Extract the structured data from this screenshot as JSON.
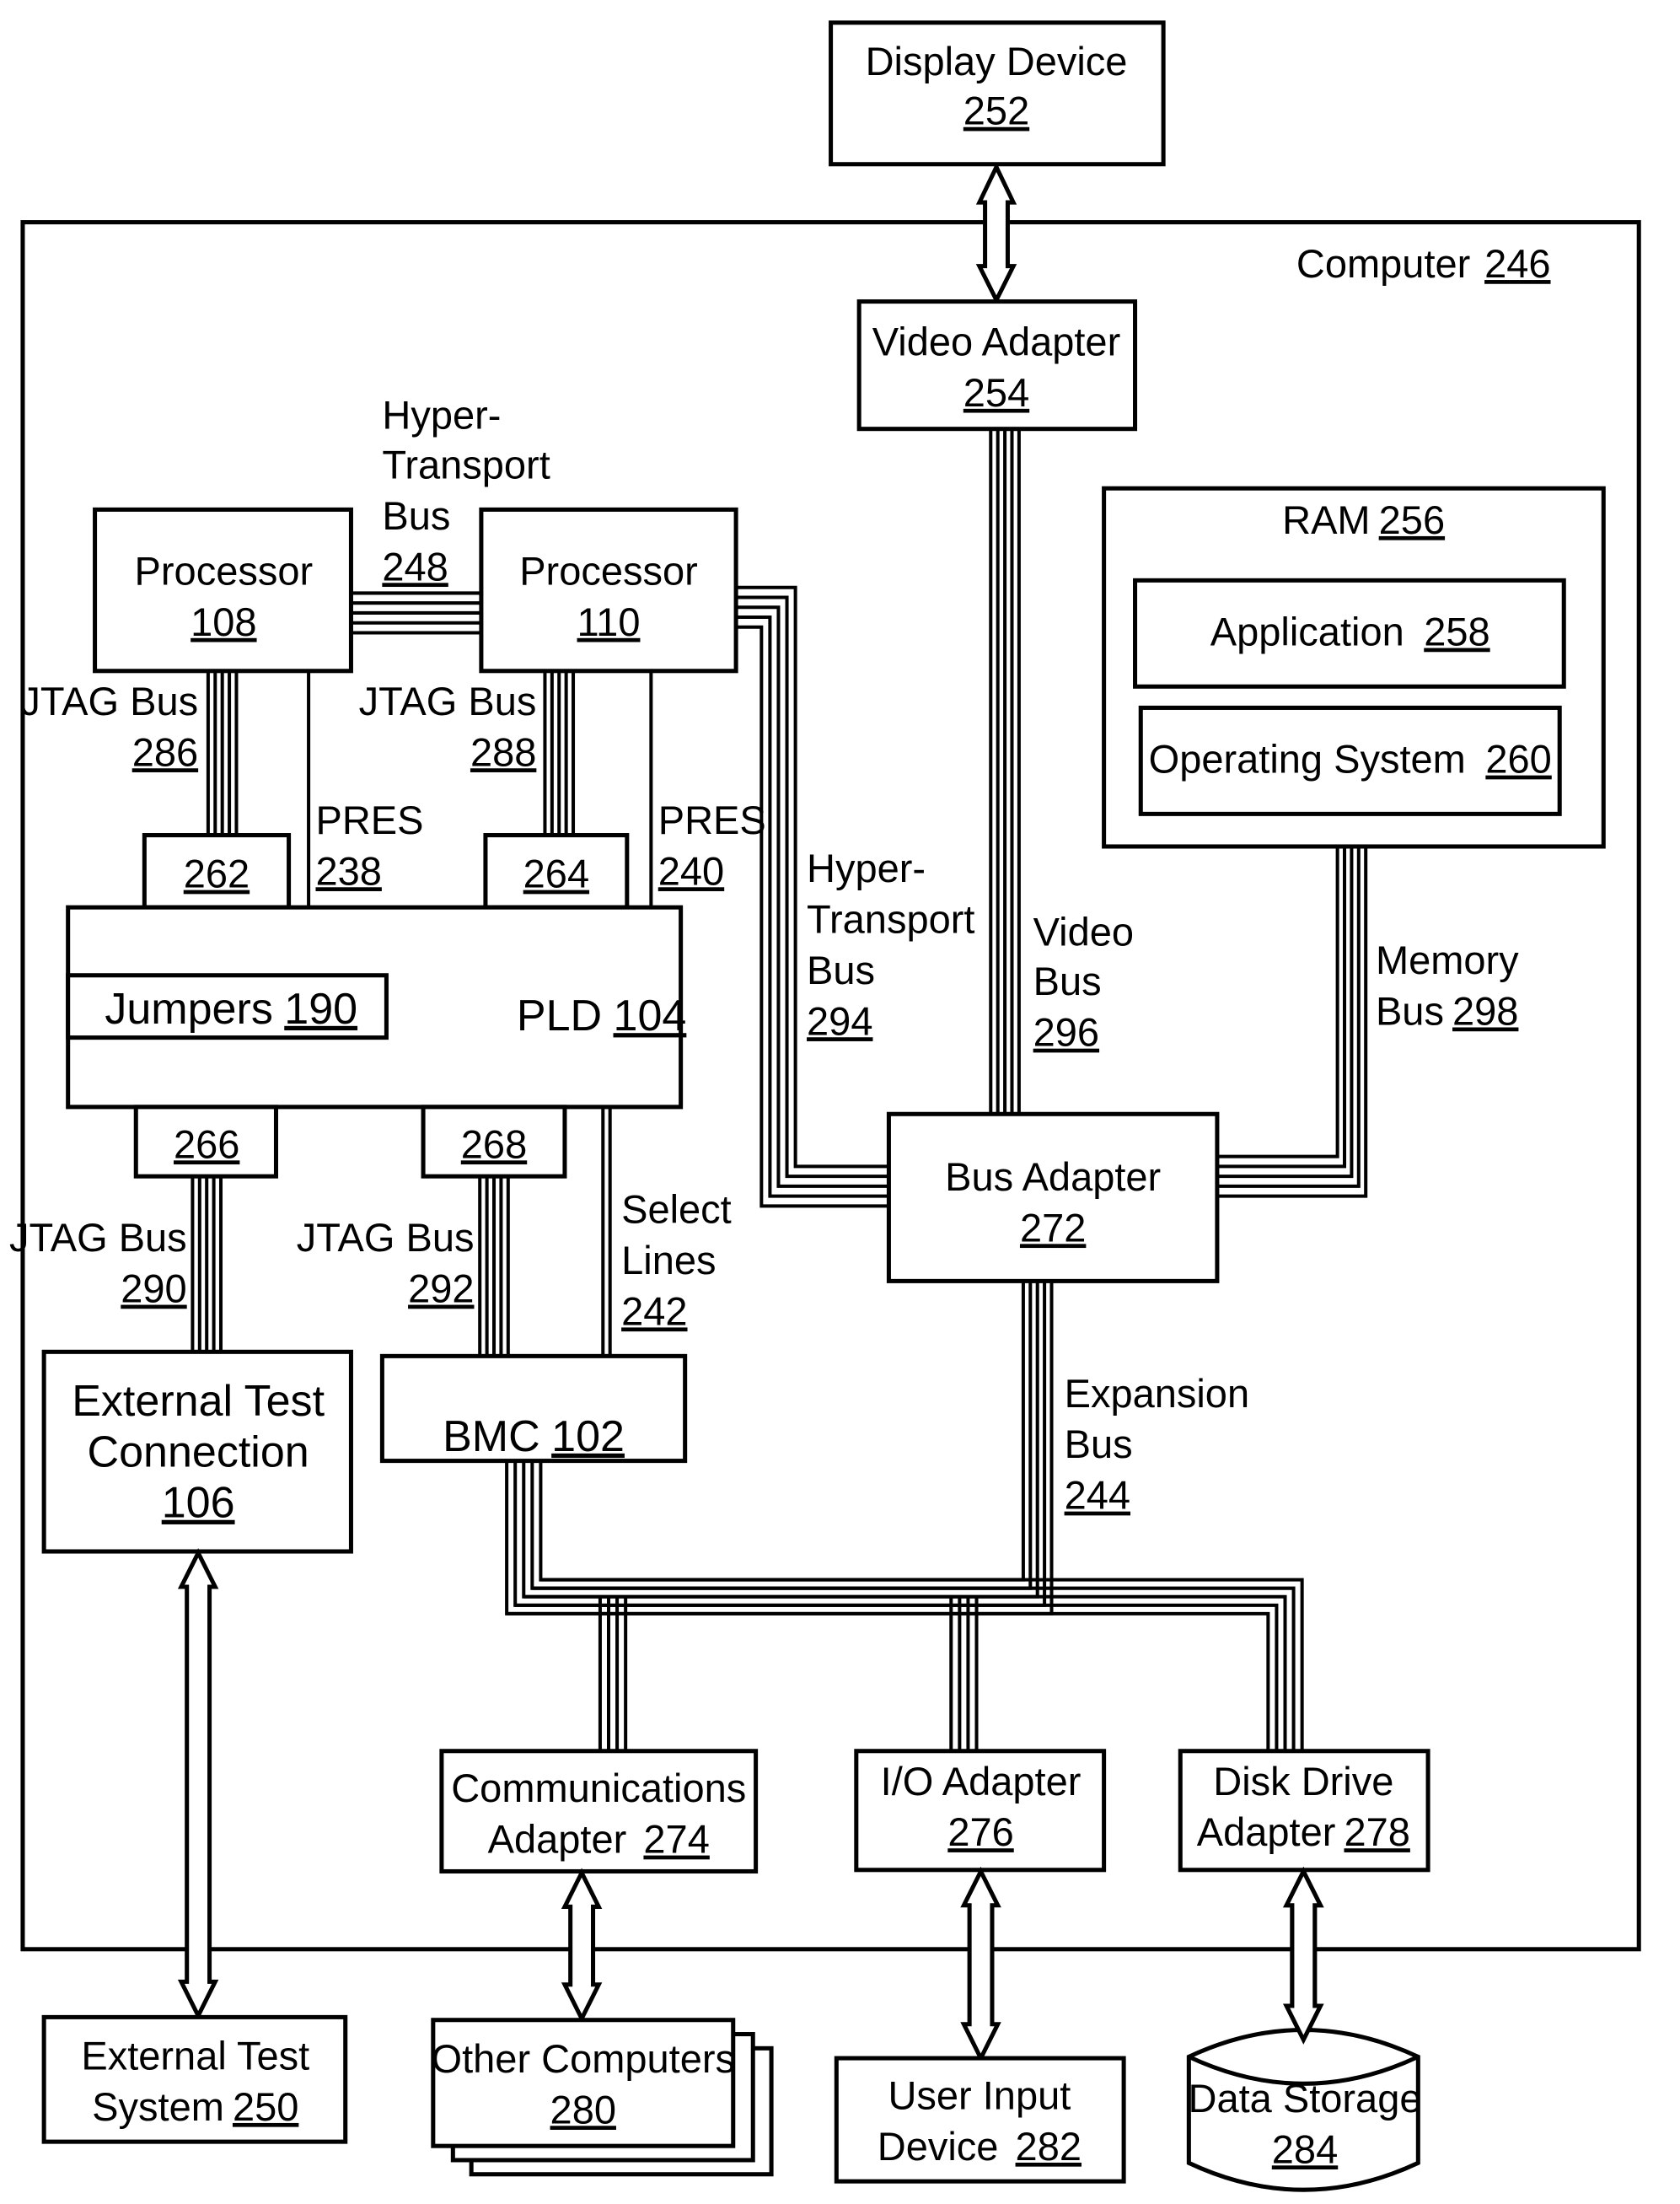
{
  "diagram": {
    "computer": {
      "label": "Computer",
      "ref": "246"
    },
    "display_device": {
      "label": "Display Device",
      "ref": "252"
    },
    "video_adapter": {
      "label": "Video Adapter",
      "ref": "254"
    },
    "ram": {
      "label": "RAM",
      "ref": "256"
    },
    "application": {
      "label": "Application",
      "ref": "258"
    },
    "operating_system": {
      "label": "Operating System",
      "ref": "260"
    },
    "processor_108": {
      "label": "Processor",
      "ref": "108"
    },
    "processor_110": {
      "label": "Processor",
      "ref": "110"
    },
    "ht_bus_248": {
      "line1": "Hyper-",
      "line2": "Transport",
      "line3": "Bus",
      "ref": "248"
    },
    "jtag_286": {
      "label": "JTAG Bus",
      "ref": "286"
    },
    "jtag_288": {
      "label": "JTAG Bus",
      "ref": "288"
    },
    "pres_238": {
      "label": "PRES",
      "ref": "238"
    },
    "pres_240": {
      "label": "PRES",
      "ref": "240"
    },
    "port_262": {
      "ref": "262"
    },
    "port_264": {
      "ref": "264"
    },
    "port_266": {
      "ref": "266"
    },
    "port_268": {
      "ref": "268"
    },
    "pld": {
      "label": "PLD",
      "ref": "104"
    },
    "jumpers": {
      "label": "Jumpers",
      "ref": "190"
    },
    "ht_bus_294": {
      "line1": "Hyper-",
      "line2": "Transport",
      "line3": "Bus",
      "ref": "294"
    },
    "video_bus": {
      "line1": "Video",
      "line2": "Bus",
      "ref": "296"
    },
    "memory_bus": {
      "line1": "Memory",
      "line2": "Bus",
      "ref": "298"
    },
    "bus_adapter": {
      "label": "Bus Adapter",
      "ref": "272"
    },
    "jtag_290": {
      "label": "JTAG Bus",
      "ref": "290"
    },
    "jtag_292": {
      "label": "JTAG Bus",
      "ref": "292"
    },
    "select_lines": {
      "line1": "Select",
      "line2": "Lines",
      "ref": "242"
    },
    "expansion_bus": {
      "line1": "Expansion",
      "line2": "Bus",
      "ref": "244"
    },
    "ext_test_conn": {
      "line1": "External Test",
      "line2": "Connection",
      "ref": "106"
    },
    "bmc": {
      "label": "BMC",
      "ref": "102"
    },
    "comm_adapter": {
      "line1": "Communications",
      "line2": "Adapter",
      "ref": "274"
    },
    "io_adapter": {
      "label": "I/O Adapter",
      "ref": "276"
    },
    "disk_adapter": {
      "line1": "Disk Drive",
      "line2": "Adapter",
      "ref": "278"
    },
    "ext_test_system": {
      "line1": "External Test",
      "line2": "System",
      "ref": "250"
    },
    "other_computers": {
      "label": "Other Computers",
      "ref": "280"
    },
    "user_input": {
      "line1": "User Input",
      "line2": "Device",
      "ref": "282"
    },
    "data_storage": {
      "label": "Data Storage",
      "ref": "284"
    }
  }
}
